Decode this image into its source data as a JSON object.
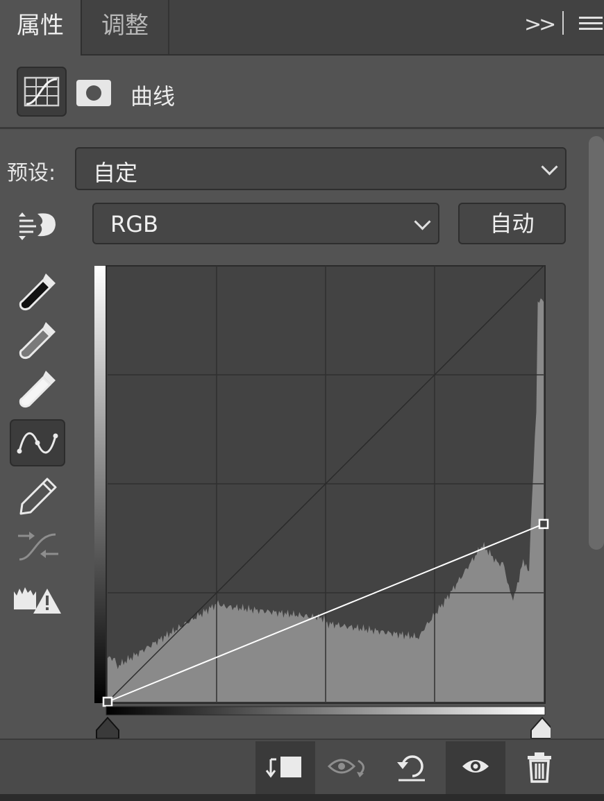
{
  "tabs": [
    {
      "label": "属性",
      "active": true
    },
    {
      "label": "调整",
      "active": false
    }
  ],
  "header": {
    "title": "曲线",
    "icons": [
      "curves-adjustment-icon",
      "layer-mask-icon"
    ]
  },
  "preset": {
    "label": "预设:",
    "value": "自定"
  },
  "channel": {
    "value": "RGB",
    "auto_label": "自动"
  },
  "tools": [
    "on-image-adjust-icon",
    "black-point-eyedropper-icon",
    "gray-point-eyedropper-icon",
    "white-point-eyedropper-icon",
    "curve-point-tool-icon",
    "pencil-draw-icon",
    "smooth-curve-icon",
    "clipping-warning-icon"
  ],
  "curve": {
    "input_range": [
      0,
      255
    ],
    "output_range": [
      0,
      255
    ],
    "points": [
      [
        0,
        0
      ],
      [
        255,
        104
      ]
    ],
    "grid_divisions": 4
  },
  "colors": {
    "panel_bg": "#535353",
    "graph_bg": "#434343",
    "histogram": "#8a8a8a",
    "curve": "#ffffff"
  },
  "bottom_buttons": [
    "clip-to-layer-icon",
    "view-previous-state-icon",
    "reset-adjustments-icon",
    "toggle-visibility-icon",
    "delete-adjustment-icon"
  ]
}
